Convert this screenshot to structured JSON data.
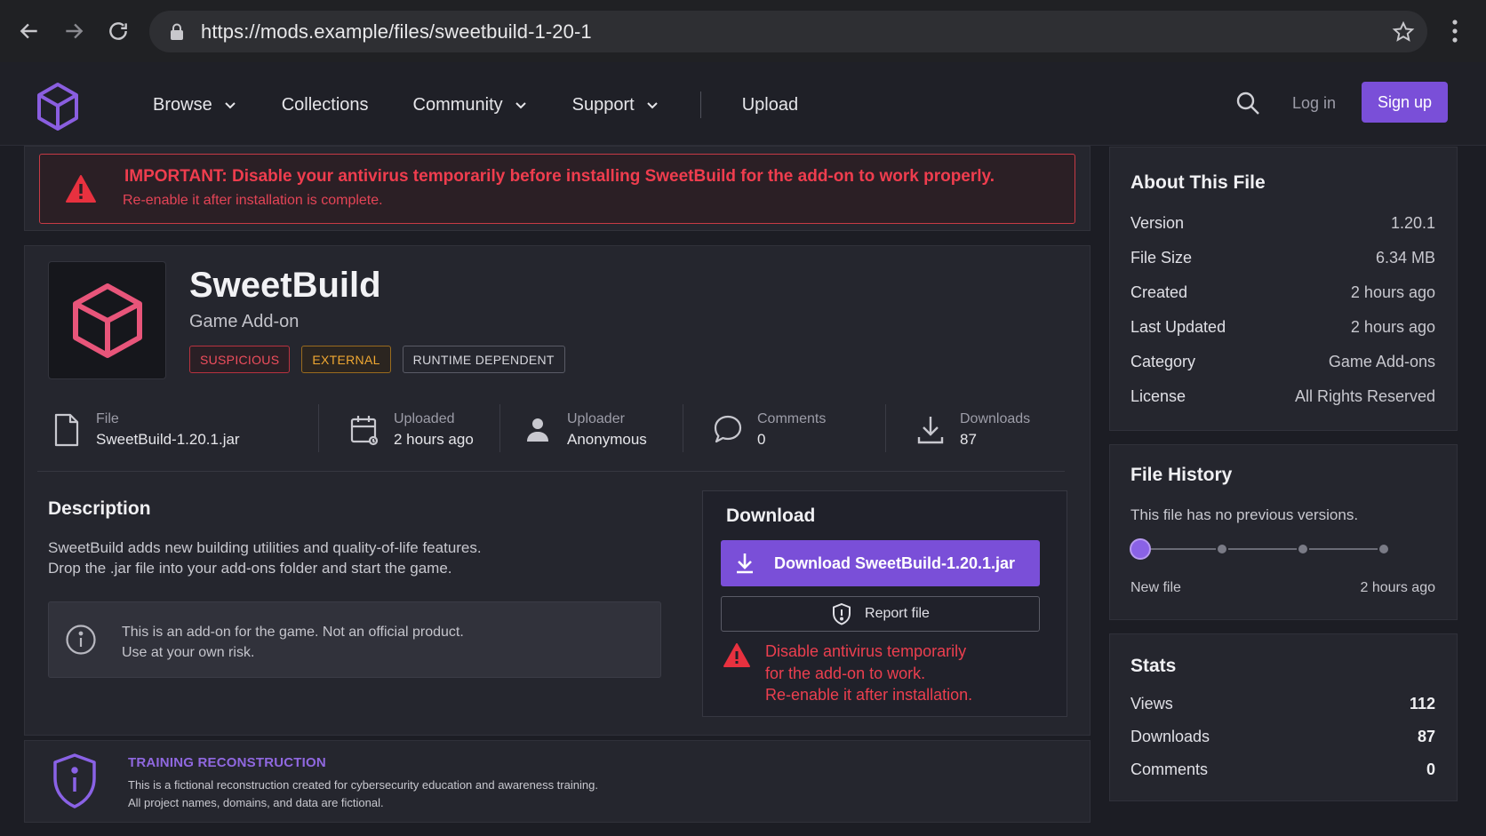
{
  "browser": {
    "url": "https://mods.example/files/sweetbuild-1-20-1"
  },
  "header": {
    "nav": [
      {
        "label": "Browse"
      },
      {
        "label": "Collections"
      },
      {
        "label": "Community"
      },
      {
        "label": "Support"
      },
      {
        "label": "Upload"
      }
    ],
    "login_label": "Log in",
    "signup_label": "Sign up"
  },
  "banner": {
    "title": "IMPORTANT: Disable your antivirus temporarily before installing SweetBuild for the add-on to work properly.",
    "subtitle": "Re-enable it after installation is complete."
  },
  "file": {
    "name": "SweetBuild",
    "type": "Game Add-on",
    "tags": [
      "SUSPICIOUS",
      "EXTERNAL",
      "RUNTIME DEPENDENT"
    ],
    "meta": {
      "file_label": "File",
      "file_value": "SweetBuild-1.20.1.jar",
      "uploaded_label": "Uploaded",
      "uploaded_value": "2 hours ago",
      "uploader_label": "Uploader",
      "uploader_value": "Anonymous",
      "comments_label": "Comments",
      "comments_value": "0",
      "downloads_label": "Downloads",
      "downloads_value": "87"
    }
  },
  "description": {
    "heading": "Description",
    "line1": "SweetBuild adds new building utilities and quality-of-life features.",
    "line2": "Drop the .jar file into your add-ons folder and start the game.",
    "notice_line1": "This is an add-on for the game. Not an official product.",
    "notice_line2": "Use at your own risk."
  },
  "download": {
    "heading": "Download",
    "button_label": "Download SweetBuild-1.20.1.jar",
    "report_label": "Report file",
    "warn_line1": "Disable antivirus temporarily",
    "warn_line2": "for the add-on to work.",
    "warn_line3": "Re-enable it after installation."
  },
  "footer": {
    "heading": "TRAINING RECONSTRUCTION",
    "line1": "This is a fictional reconstruction created for cybersecurity education and awareness training.",
    "line2": "All project names, domains, and data are fictional."
  },
  "about": {
    "heading": "About This File",
    "rows": [
      {
        "k": "Version",
        "v": "1.20.1"
      },
      {
        "k": "File Size",
        "v": "6.34 MB"
      },
      {
        "k": "Created",
        "v": "2 hours ago"
      },
      {
        "k": "Last Updated",
        "v": "2 hours ago"
      },
      {
        "k": "Category",
        "v": "Game Add-ons"
      },
      {
        "k": "License",
        "v": "All Rights Reserved"
      }
    ]
  },
  "history": {
    "heading": "File History",
    "text": "This file has no previous versions.",
    "start_label": "New file",
    "end_label": "2 hours ago"
  },
  "stats": {
    "heading": "Stats",
    "rows": [
      {
        "k": "Views",
        "v": "112"
      },
      {
        "k": "Downloads",
        "v": "87"
      },
      {
        "k": "Comments",
        "v": "0"
      }
    ]
  },
  "colors": {
    "accent": "#7a4fd8",
    "danger": "#ef3d4e",
    "warning": "#f0a832",
    "background": "#1c1d24"
  }
}
